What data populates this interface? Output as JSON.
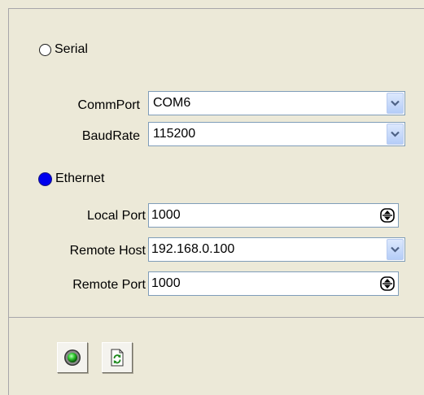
{
  "connection": {
    "serial": {
      "label": "Serial",
      "selected": false
    },
    "ethernet": {
      "label": "Ethernet",
      "selected": true
    }
  },
  "serial_fields": {
    "commport": {
      "label": "CommPort",
      "value": "COM6"
    },
    "baudrate": {
      "label": "BaudRate",
      "value": "115200"
    }
  },
  "ethernet_fields": {
    "local_port": {
      "label": "Local Port",
      "value": "1000"
    },
    "remote_host": {
      "label": "Remote Host",
      "value": "192.168.0.100"
    },
    "remote_port": {
      "label": "Remote Port",
      "value": "1000"
    }
  },
  "toolbar": {
    "connect_icon": "connect-status-icon",
    "refresh_icon": "refresh-icon"
  },
  "colors": {
    "selected_radio": "#0000ee",
    "connect_green": "#33cc33"
  }
}
